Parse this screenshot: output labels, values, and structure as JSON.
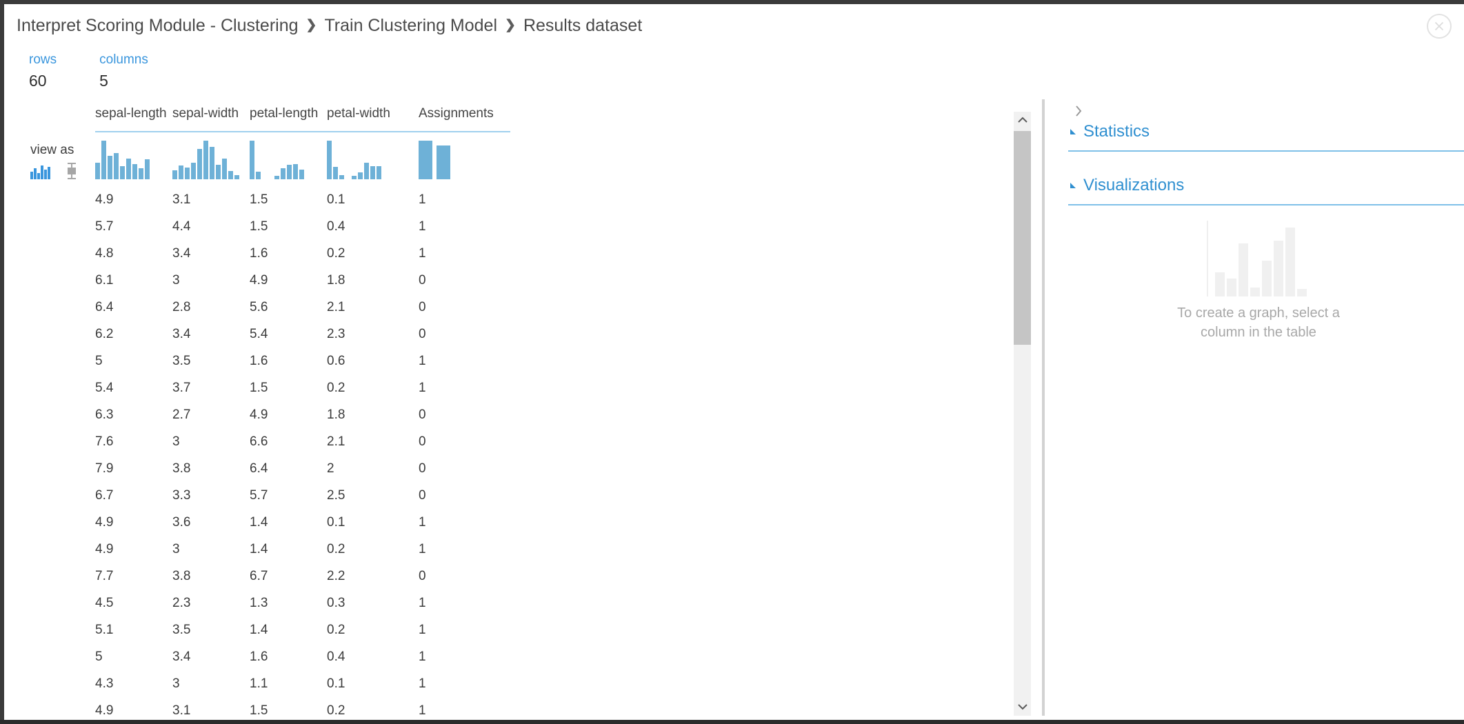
{
  "window": {
    "close_icon": "close-circle-icon"
  },
  "breadcrumb": {
    "separator": "❯",
    "items": [
      "Interpret Scoring Module - Clustering",
      "Train Clustering Model",
      "Results dataset"
    ]
  },
  "summary": {
    "rows_label": "rows",
    "rows_value": "60",
    "columns_label": "columns",
    "columns_value": "5"
  },
  "view_as": {
    "label": "view as",
    "options": [
      {
        "name": "histogram-icon",
        "selected": true
      },
      {
        "name": "boxplot-icon",
        "selected": false
      }
    ]
  },
  "table": {
    "columns": [
      "sepal-length",
      "sepal-width",
      "petal-length",
      "petal-width",
      "Assignments"
    ],
    "rows": [
      [
        "4.9",
        "3.1",
        "1.5",
        "0.1",
        "1"
      ],
      [
        "5.7",
        "4.4",
        "1.5",
        "0.4",
        "1"
      ],
      [
        "4.8",
        "3.4",
        "1.6",
        "0.2",
        "1"
      ],
      [
        "6.1",
        "3",
        "4.9",
        "1.8",
        "0"
      ],
      [
        "6.4",
        "2.8",
        "5.6",
        "2.1",
        "0"
      ],
      [
        "6.2",
        "3.4",
        "5.4",
        "2.3",
        "0"
      ],
      [
        "5",
        "3.5",
        "1.6",
        "0.6",
        "1"
      ],
      [
        "5.4",
        "3.7",
        "1.5",
        "0.2",
        "1"
      ],
      [
        "6.3",
        "2.7",
        "4.9",
        "1.8",
        "0"
      ],
      [
        "7.6",
        "3",
        "6.6",
        "2.1",
        "0"
      ],
      [
        "7.9",
        "3.8",
        "6.4",
        "2",
        "0"
      ],
      [
        "6.7",
        "3.3",
        "5.7",
        "2.5",
        "0"
      ],
      [
        "4.9",
        "3.6",
        "1.4",
        "0.1",
        "1"
      ],
      [
        "4.9",
        "3",
        "1.4",
        "0.2",
        "1"
      ],
      [
        "7.7",
        "3.8",
        "6.7",
        "2.2",
        "0"
      ],
      [
        "4.5",
        "2.3",
        "1.3",
        "0.3",
        "1"
      ],
      [
        "5.1",
        "3.5",
        "1.4",
        "0.2",
        "1"
      ],
      [
        "5",
        "3.4",
        "1.6",
        "0.4",
        "1"
      ],
      [
        "4.3",
        "3",
        "1.1",
        "0.1",
        "1"
      ],
      [
        "4.9",
        "3.1",
        "1.5",
        "0.2",
        "1"
      ]
    ]
  },
  "chart_data": [
    {
      "type": "bar",
      "title": "sepal-length",
      "categories": [
        "b1",
        "b2",
        "b3",
        "b4",
        "b5",
        "b6",
        "b7",
        "b8",
        "b9"
      ],
      "values": [
        24,
        56,
        34,
        38,
        19,
        30,
        22,
        16,
        29
      ],
      "ylim": [
        0,
        56
      ]
    },
    {
      "type": "bar",
      "title": "sepal-width",
      "categories": [
        "b1",
        "b2",
        "b3",
        "b4",
        "b5",
        "b6",
        "b7",
        "b8",
        "b9",
        "b10"
      ],
      "values": [
        13,
        20,
        17,
        24,
        44,
        56,
        47,
        21,
        30,
        12,
        6
      ],
      "ylim": [
        0,
        56
      ]
    },
    {
      "type": "bar",
      "title": "petal-length",
      "categories": [
        "b1",
        "b2",
        "g",
        "g",
        "g",
        "b3",
        "b4",
        "b5",
        "b6",
        "b7"
      ],
      "values": [
        56,
        11,
        0,
        0,
        5,
        16,
        21,
        22,
        14
      ],
      "ylim": [
        0,
        56
      ]
    },
    {
      "type": "bar",
      "title": "petal-width",
      "categories": [
        "b1",
        "b2",
        "b3",
        "g",
        "b4",
        "b5",
        "b6",
        "b7",
        "b8"
      ],
      "values": [
        56,
        18,
        6,
        0,
        5,
        10,
        24,
        19,
        19
      ],
      "ylim": [
        0,
        56
      ]
    },
    {
      "type": "bar",
      "title": "Assignments",
      "categories": [
        "0",
        "1"
      ],
      "values": [
        56,
        49
      ],
      "ylim": [
        0,
        56
      ]
    }
  ],
  "scrollbar": {
    "up_icon": "chevron-up-icon",
    "down_icon": "chevron-down-icon"
  },
  "right_panel": {
    "expand_icon": "chevron-right-icon",
    "sections": [
      {
        "title": "Statistics",
        "caret": "caret-up-icon"
      },
      {
        "title": "Visualizations",
        "caret": "caret-up-icon"
      }
    ],
    "empty_state": {
      "text": "To create a graph, select a column in the table",
      "bars": [
        22,
        16,
        48,
        8,
        32,
        50,
        62,
        7
      ]
    }
  },
  "colors": {
    "accent": "#3a96dd",
    "histogram_bar": "#6eb1d7",
    "rule": "#7fc0e8",
    "text": "#3b3b3b",
    "muted": "#a8a8a8"
  }
}
